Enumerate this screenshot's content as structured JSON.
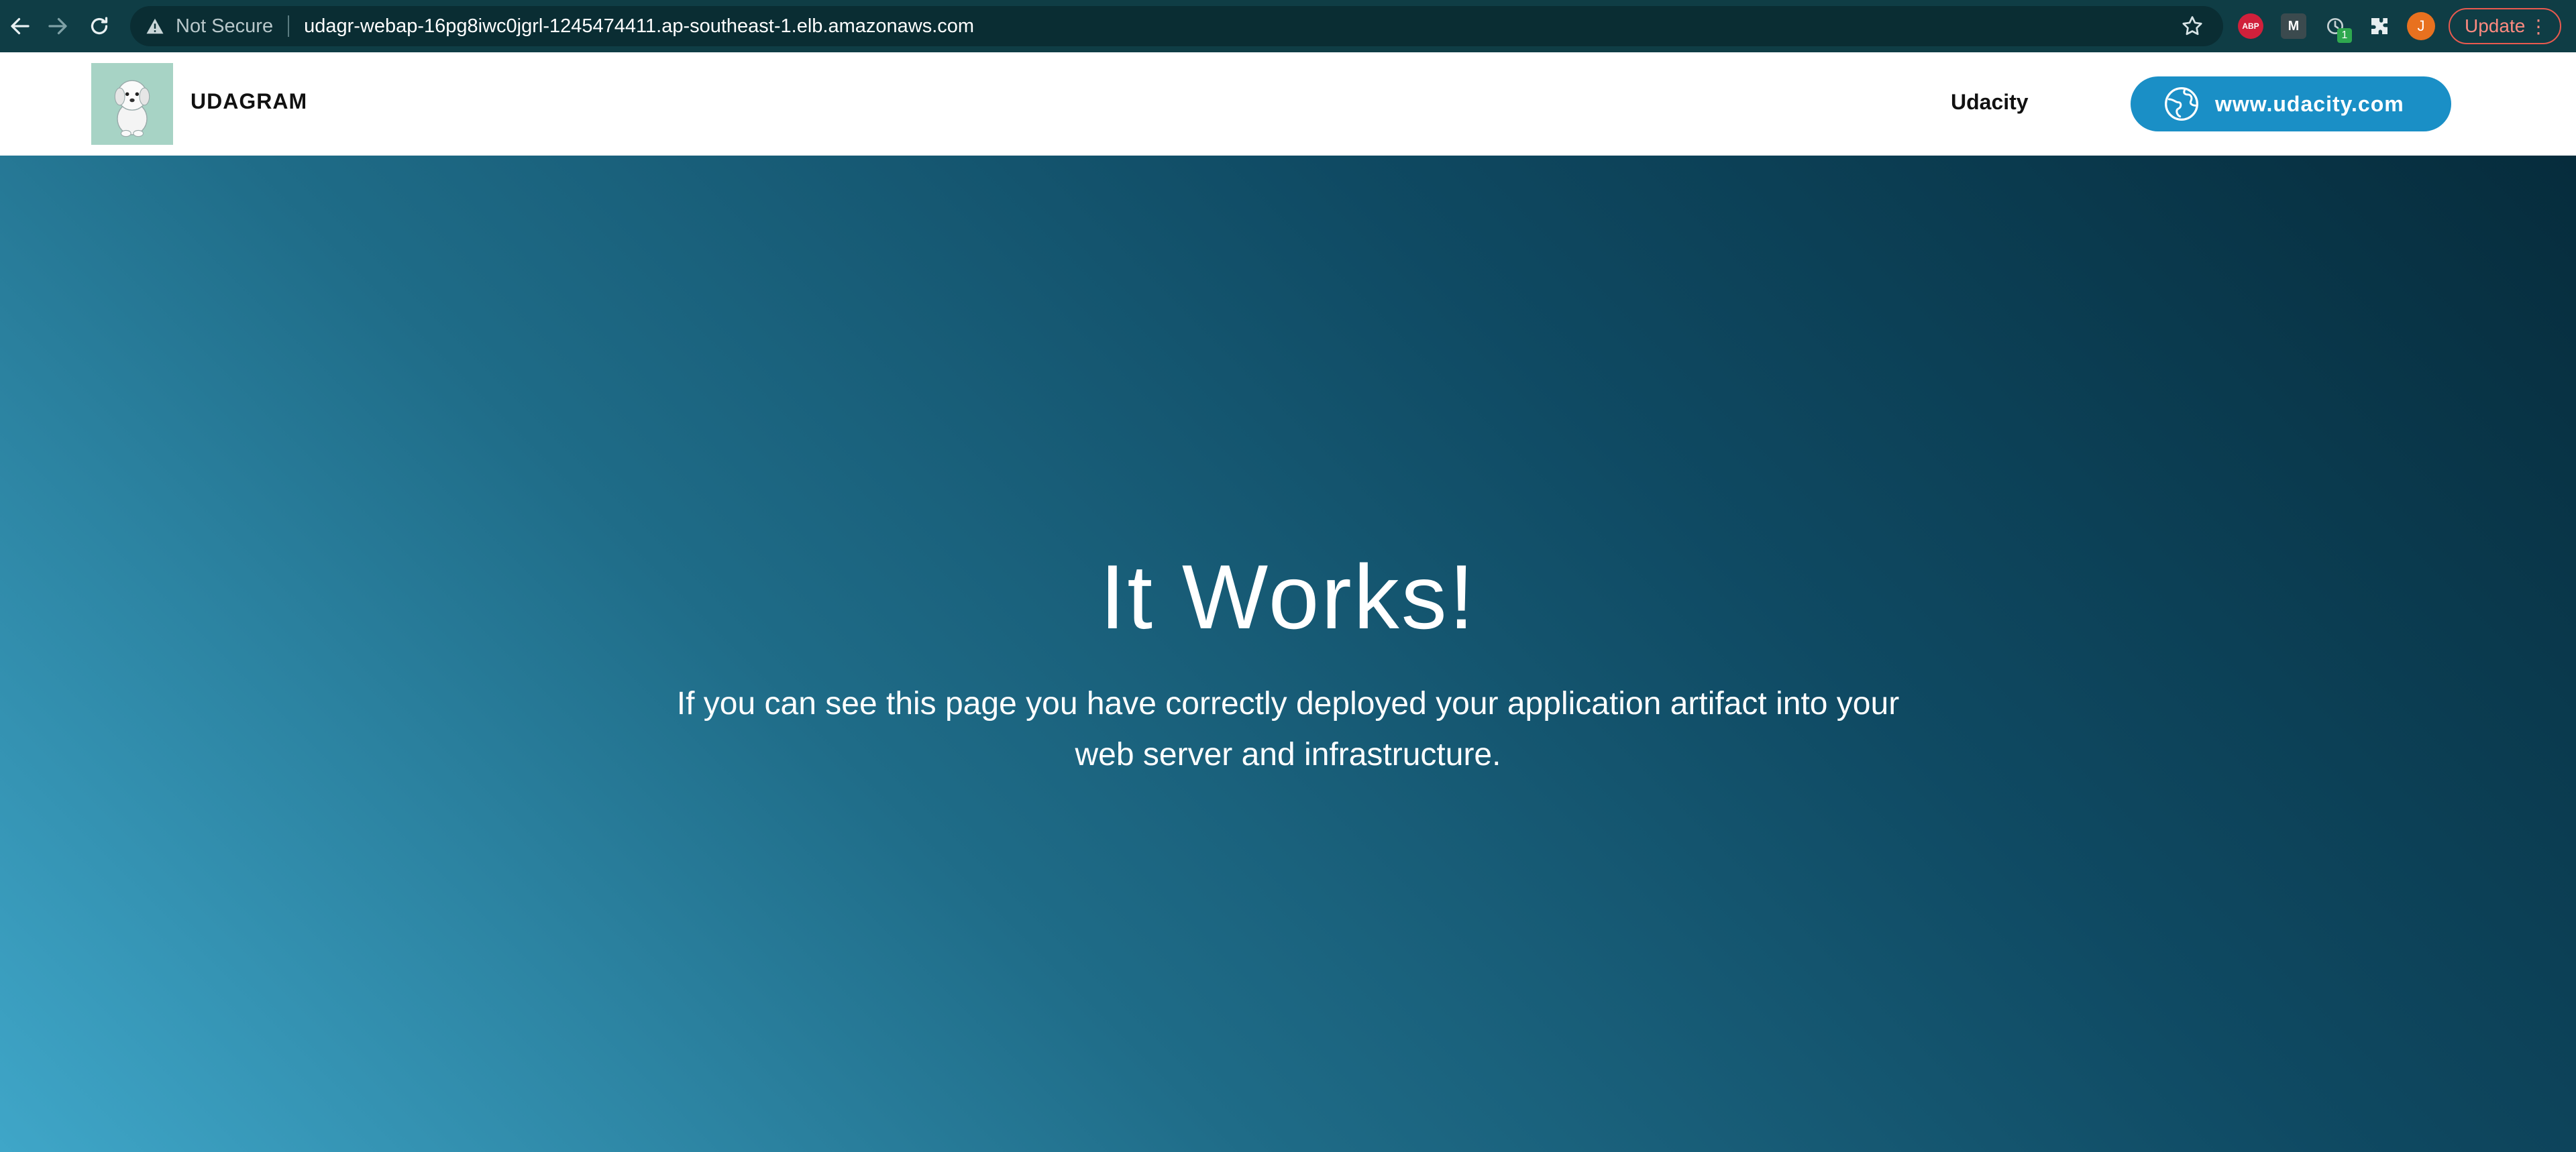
{
  "browser": {
    "security_label": "Not Secure",
    "url": "udagr-webap-16pg8iwc0jgrl-1245474411.ap-southeast-1.elb.amazonaws.com",
    "extensions": [
      {
        "name": "adblock-icon",
        "label": "ABP"
      },
      {
        "name": "m-extension-icon",
        "label": "M"
      },
      {
        "name": "clock-extension-icon",
        "badge": "1"
      },
      {
        "name": "puzzle-icon"
      }
    ],
    "profile_initial": "J",
    "update_label": "Update",
    "colors": {
      "toolbar": "#0f3d45",
      "update_accent": "#e85a4f"
    }
  },
  "site": {
    "brand": "UDAGRAM",
    "nav_link": "Udacity",
    "cta_label": "www.udacity.com",
    "colors": {
      "cta": "#1a8fc6",
      "header_bg": "#ffffff"
    }
  },
  "hero": {
    "title": "It Works!",
    "text": "If you can see this page you have correctly deployed your application artifact into your web server and infrastructure.",
    "colors": {
      "gradient_dark": "#062c3c",
      "gradient_light": "#3fa6c8"
    }
  }
}
